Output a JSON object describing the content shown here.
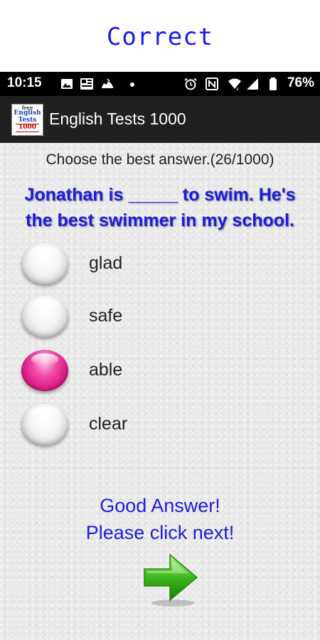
{
  "banner": {
    "text": "Correct"
  },
  "status_bar": {
    "time": "10:15",
    "battery": "76%",
    "icons": [
      "image-icon",
      "news-icon",
      "running-shoe-icon",
      "dot-icon",
      "alarm-icon",
      "nfc-icon",
      "wifi-icon",
      "signal-icon",
      "battery-icon"
    ]
  },
  "app_bar": {
    "title": "English Tests 1000",
    "logo": {
      "line1": "free",
      "line2": "English",
      "line3": "Tests",
      "line4": "1000"
    }
  },
  "quiz": {
    "instruction": "Choose the best answer.(26/1000)",
    "question_line1": "Jonathan is _____ to swim. He's",
    "question_line2": "the best swimmer in my school.",
    "options": [
      {
        "label": "glad",
        "selected": false
      },
      {
        "label": "safe",
        "selected": false
      },
      {
        "label": "able",
        "selected": true
      },
      {
        "label": "clear",
        "selected": false
      }
    ],
    "feedback_line1": "Good Answer!",
    "feedback_line2": "Please click next!",
    "selected_color": "#e0288e",
    "question_color": "#1c1ce0",
    "next_arrow_color": "#3cb81c"
  }
}
